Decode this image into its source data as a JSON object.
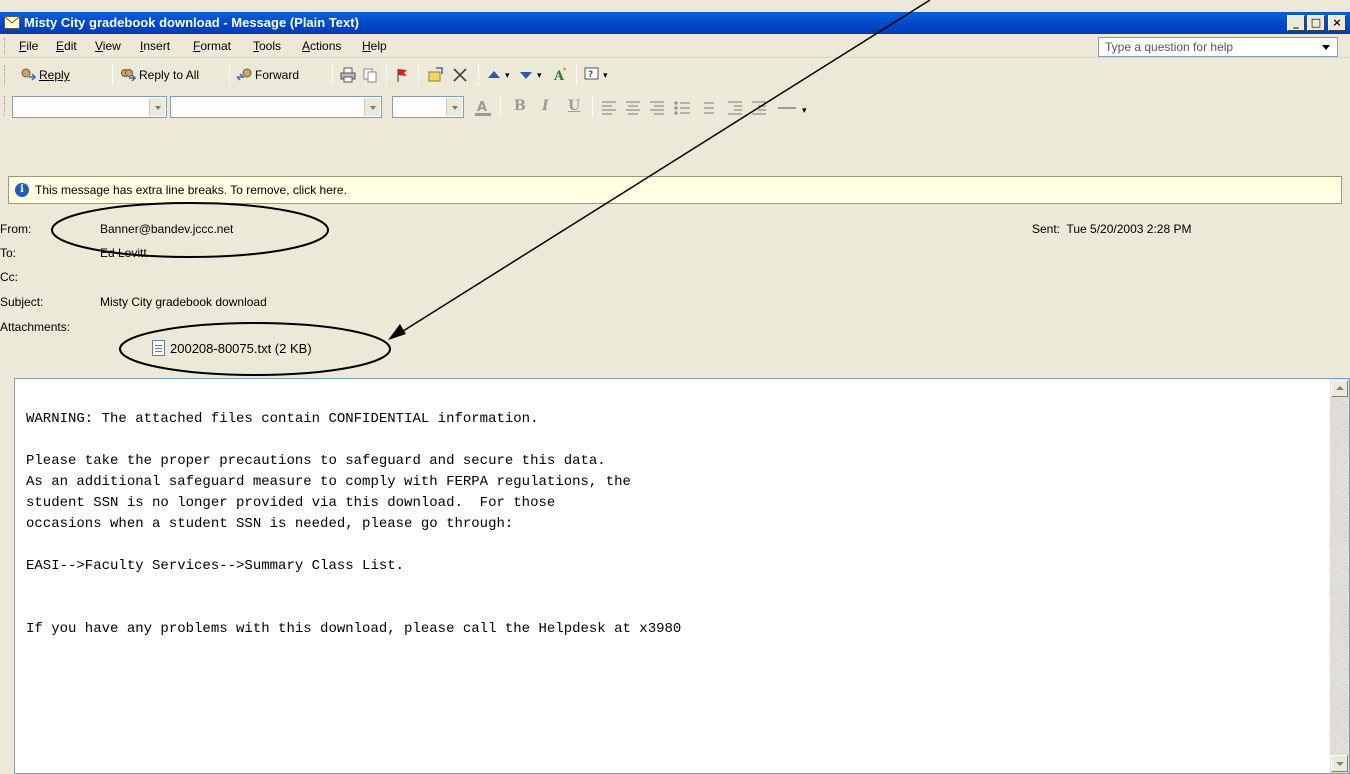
{
  "window": {
    "title": "Misty City gradebook download - Message (Plain Text)",
    "controls": {
      "minimize": "_",
      "maximize": "□",
      "close": "×"
    }
  },
  "menubar": {
    "items": [
      "File",
      "Edit",
      "View",
      "Insert",
      "Format",
      "Tools",
      "Actions",
      "Help"
    ],
    "help_placeholder": "Type a question for help"
  },
  "toolbar": {
    "reply": "Reply",
    "reply_all": "Reply to All",
    "forward": "Forward"
  },
  "formatting": {
    "bold": "B",
    "italic": "I",
    "underline": "U"
  },
  "infobar": {
    "text": "This message has extra line breaks. To remove, click here."
  },
  "headers": {
    "from_label": "From:",
    "from": "Banner@bandev.jccc.net",
    "to_label": "To:",
    "to": "Ed Lovitt",
    "cc_label": "Cc:",
    "cc": "",
    "subject_label": "Subject:",
    "subject": "Misty City gradebook download",
    "attachments_label": "Attachments:",
    "attachment": "200208-80075.txt (2 KB)",
    "sent_label": "Sent:",
    "sent": "Tue 5/20/2003 2:28 PM"
  },
  "body": {
    "text": "WARNING: The attached files contain CONFIDENTIAL information.\n\nPlease take the proper precautions to safeguard and secure this data.\nAs an additional safeguard measure to comply with FERPA regulations, the\nstudent SSN is no longer provided via this download.  For those\noccasions when a student SSN is needed, please go through:\n\nEASI-->Faculty Services-->Summary Class List.\n\n\nIf you have any problems with this download, please call the Helpdesk at x3980"
  },
  "colors": {
    "titlebar": "#0047c9",
    "infobar_bg": "#ffffe1",
    "chrome": "#ece9d8"
  }
}
